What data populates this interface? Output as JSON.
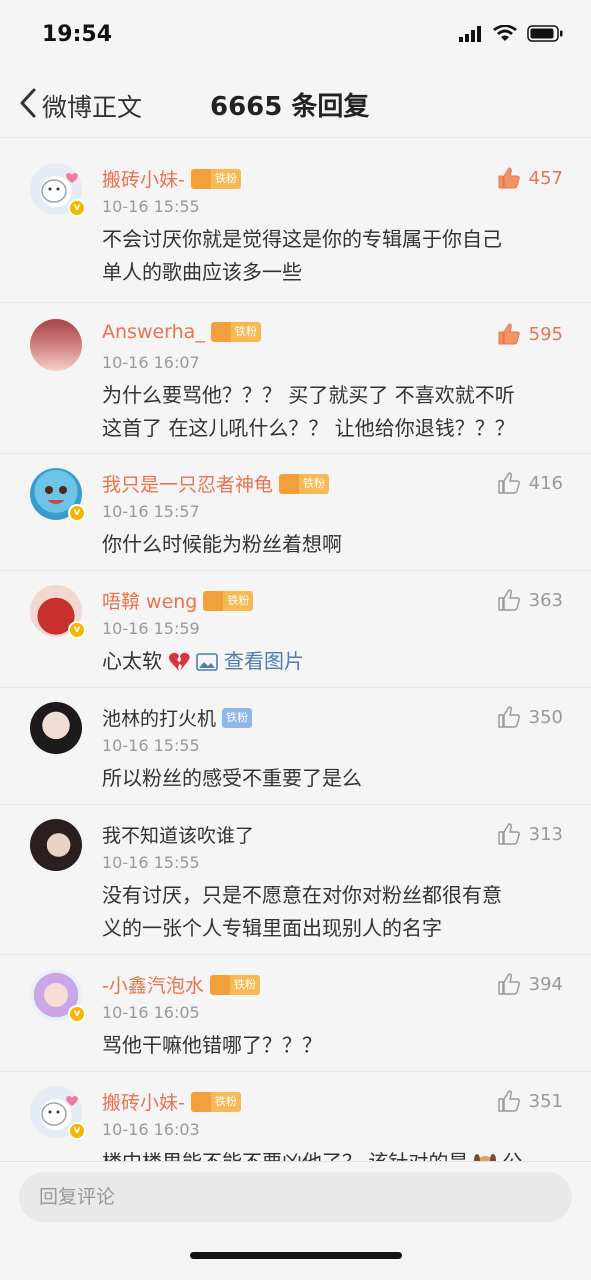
{
  "status": {
    "time": "19:54"
  },
  "nav": {
    "back_label": "微博正文",
    "title": "6665 条回复"
  },
  "comments": [
    {
      "user": "搬砖小妹-",
      "badge": "铁粉",
      "time": "10-16 15:55",
      "likes": "457",
      "hot": true,
      "lines": [
        "不会讨厌你就是觉得这是你的专辑属于你自己",
        "单人的歌曲应该多一些"
      ]
    },
    {
      "user": "Answerha_",
      "badge": "铁粉",
      "time": "10-16 16:07",
      "likes": "595",
      "hot": true,
      "lines": [
        "为什么要骂他？？？ 买了就买了 不喜欢就不听",
        "这首了 在这儿吼什么？？ 让他给你退钱？？？"
      ]
    },
    {
      "user": "我只是一只忍者神龟",
      "badge": "铁粉",
      "time": "10-16 15:57",
      "likes": "416",
      "hot": false,
      "lines": [
        "你什么时候能为粉丝着想啊"
      ]
    },
    {
      "user": "唔鞥 weng",
      "badge": "铁粉",
      "time": "10-16 15:59",
      "likes": "363",
      "hot": false,
      "text": "心太软",
      "link": "查看图片"
    },
    {
      "user": "池林的打火机",
      "badge": "铁粉",
      "time": "10-16 15:55",
      "likes": "350",
      "hot": false,
      "lines": [
        "所以粉丝的感受不重要了是么"
      ]
    },
    {
      "user": "我不知道该吹谁了",
      "time": "10-16 15:55",
      "likes": "313",
      "hot": false,
      "lines": [
        "没有讨厌，只是不愿意在对你对粉丝都很有意",
        "义的一张个人专辑里面出现别人的名字"
      ]
    },
    {
      "user": "-小鑫汽泡水",
      "badge": "铁粉",
      "time": "10-16 16:05",
      "likes": "394",
      "hot": false,
      "lines": [
        "骂他干嘛他错哪了？？？"
      ]
    },
    {
      "user": "搬砖小妹-",
      "badge": "铁粉",
      "time": "10-16 16:03",
      "likes": "351",
      "hot": false,
      "lines": [
        "楼中楼里能不能不要凶他了？ 该针对的是"
      ],
      "tail": "公"
    }
  ],
  "reply": {
    "placeholder": "回复评论"
  },
  "colors": {
    "accent": "#eb7350",
    "link": "#507daf",
    "fan_gold": "#f7b955",
    "fan_blue": "#8fb6e8"
  },
  "icons": [
    "back-chevron-icon",
    "signal-icon",
    "wifi-icon",
    "battery-icon",
    "thumb-up-icon",
    "broken-heart-emoji",
    "image-icon",
    "dog-emoji"
  ]
}
